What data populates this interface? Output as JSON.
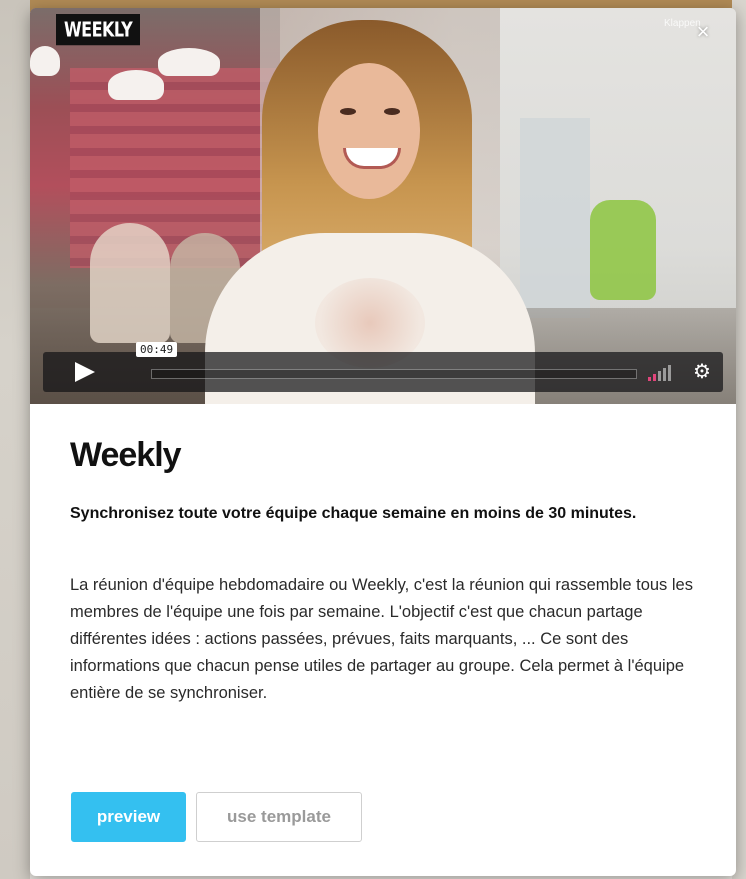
{
  "video": {
    "brand_logo": "WEEKLY",
    "close_label": "Klappen",
    "close_icon": "close-icon",
    "current_time": "00:49",
    "progress_fraction": 0.0,
    "volume_level": 0.4,
    "icons": [
      "play-icon",
      "volume-icon",
      "gear-icon"
    ],
    "colors": {
      "volume_active": "#e0457b",
      "volume_inactive": "#9a9a9a"
    }
  },
  "template": {
    "title": "Weekly",
    "subtitle": "Synchronisez toute votre équipe chaque semaine en moins de 30 minutes.",
    "description": "La réunion d'équipe hebdomadaire ou Weekly, c'est la réunion qui rassemble tous les membres de l'équipe une fois par semaine. L'objectif c'est que chacun partage différentes idées : actions passées, prévues, faits marquants, ... Ce sont des informations que chacun pense utiles de partager au groupe. Cela permet à l'équipe entière de se synchroniser."
  },
  "actions": {
    "preview_label": "preview",
    "use_template_label": "use template"
  },
  "colors": {
    "accent": "#34c0f0",
    "secondary_border": "#cfcfcf"
  }
}
